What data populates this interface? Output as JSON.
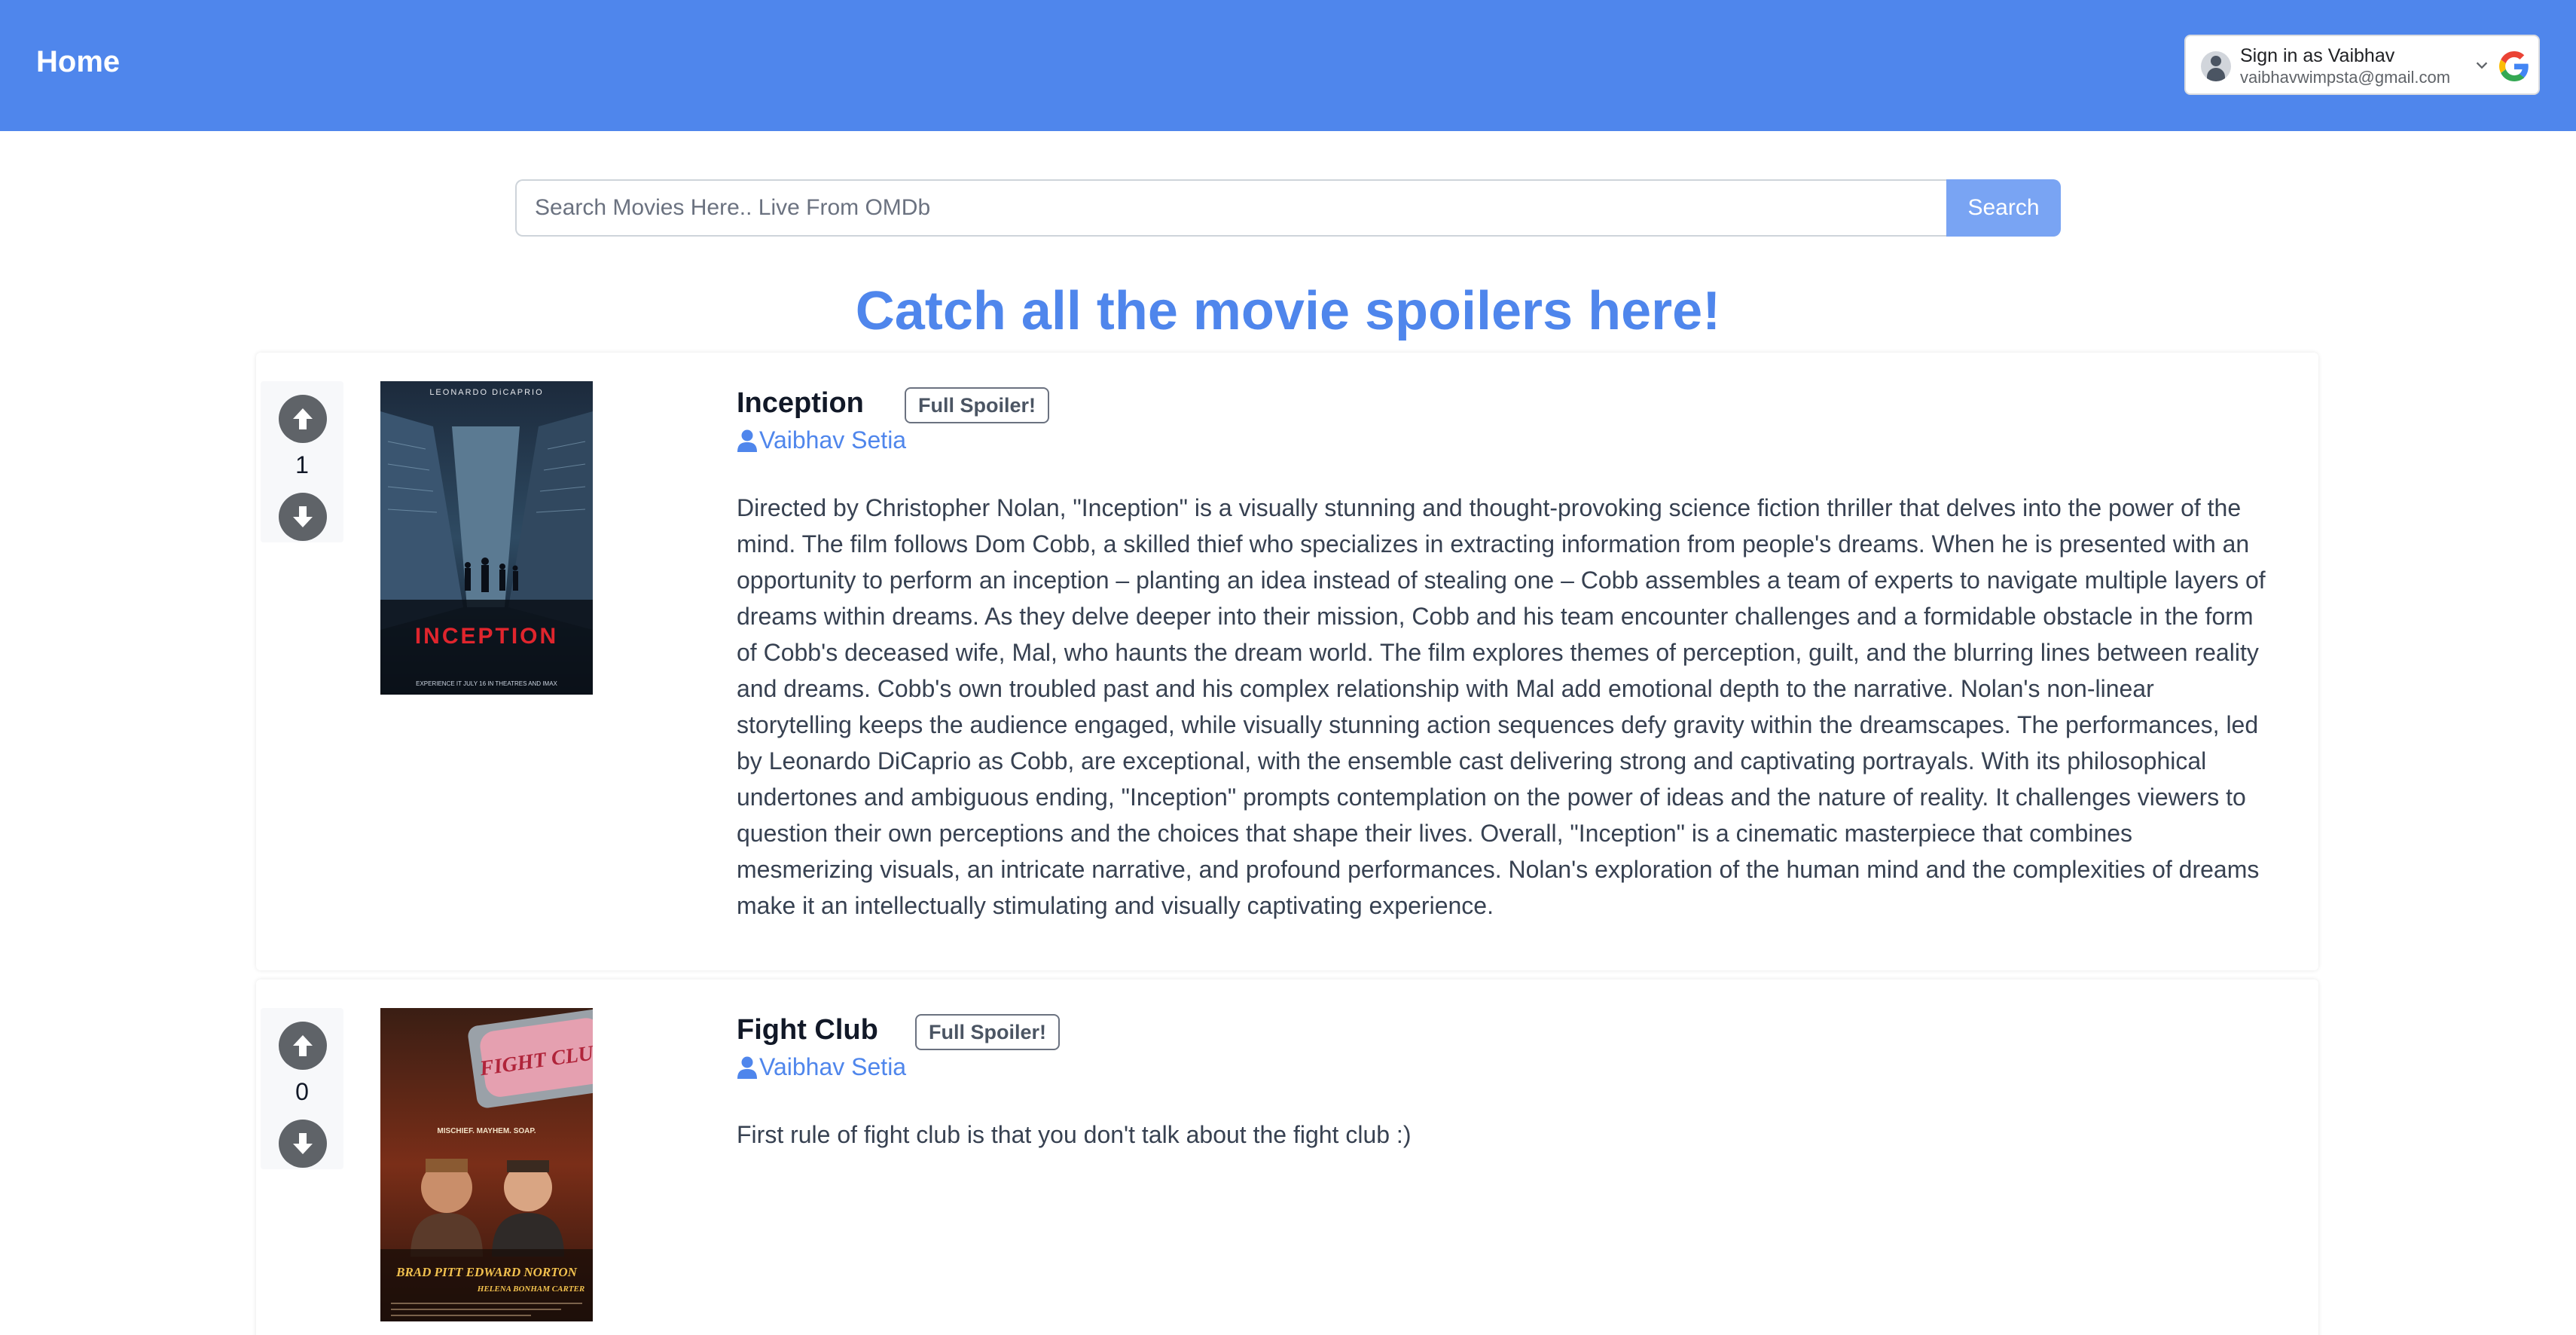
{
  "navbar": {
    "home_label": "Home",
    "signin": {
      "title": "Sign in as Vaibhav",
      "email": "vaibhavwimpsta@gmail.com"
    }
  },
  "search": {
    "placeholder": "Search Movies Here.. Live From OMDb",
    "button_label": "Search"
  },
  "headline": "Catch all the movie spoilers here!",
  "colors": {
    "brand": "#4f86ec",
    "search_button": "#79a4f3",
    "vote_button": "#5f6368"
  },
  "posts": [
    {
      "title": "Inception",
      "badge": "Full Spoiler!",
      "author": "Vaibhav Setia",
      "votes": "1",
      "poster": {
        "top_text": "LEONARDO DiCAPRIO",
        "title_text": "INCEPTION",
        "bottom_text": "EXPERIENCE IT JULY 16 IN THEATRES AND IMAX"
      },
      "review": "Directed by Christopher Nolan, \"Inception\" is a visually stunning and thought-provoking science fiction thriller that delves into the power of the mind. The film follows Dom Cobb, a skilled thief who specializes in extracting information from people's dreams. When he is presented with an opportunity to perform an inception – planting an idea instead of stealing one – Cobb assembles a team of experts to navigate multiple layers of dreams within dreams. As they delve deeper into their mission, Cobb and his team encounter challenges and a formidable obstacle in the form of Cobb's deceased wife, Mal, who haunts the dream world. The film explores themes of perception, guilt, and the blurring lines between reality and dreams. Cobb's own troubled past and his complex relationship with Mal add emotional depth to the narrative. Nolan's non-linear storytelling keeps the audience engaged, while visually stunning action sequences defy gravity within the dreamscapes. The performances, led by Leonardo DiCaprio as Cobb, are exceptional, with the ensemble cast delivering strong and captivating portrayals. With its philosophical undertones and ambiguous ending, \"Inception\" prompts contemplation on the power of ideas and the nature of reality. It challenges viewers to question their own perceptions and the choices that shape their lives. Overall, \"Inception\" is a cinematic masterpiece that combines mesmerizing visuals, an intricate narrative, and profound performances. Nolan's exploration of the human mind and the complexities of dreams make it an intellectually stimulating and visually captivating experience."
    },
    {
      "title": "Fight Club",
      "badge": "Full Spoiler!",
      "author": "Vaibhav Setia",
      "votes": "0",
      "poster": {
        "soap_text": "FIGHT CLUB",
        "tagline": "MISCHIEF. MAYHEM. SOAP.",
        "names": "BRAD PITT  EDWARD NORTON",
        "names2": "HELENA BONHAM CARTER"
      },
      "review": "First rule of fight club is that you don't talk about the fight club :)"
    }
  ]
}
